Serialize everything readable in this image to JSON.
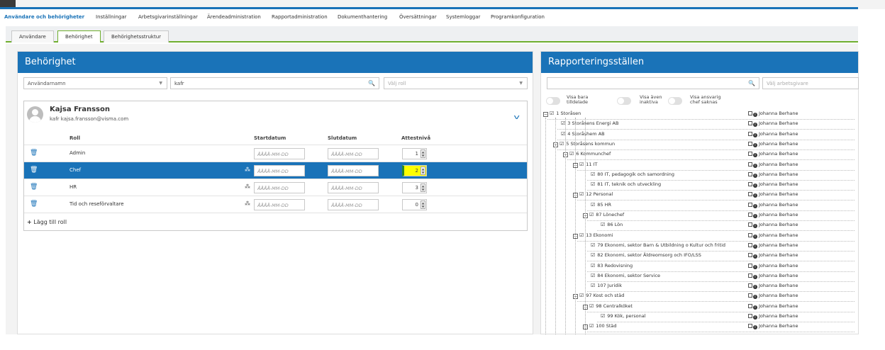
{
  "main_nav": [
    "Användare och behörigheter",
    "Inställningar",
    "Arbetsgivarinställningar",
    "Ärendeadministration",
    "Rapportadministration",
    "Dokumenthantering",
    "Översättningar",
    "Systemloggar",
    "Programkonfiguration"
  ],
  "sub_tabs": [
    "Användare",
    "Behörighet",
    "Behörighetsstruktur"
  ],
  "left_panel": {
    "title": "Behörighet",
    "filter_select": "Användarnamn",
    "search_value": "kafr",
    "role_placeholder": "Välj roll",
    "user": {
      "name": "Kajsa Fransson",
      "email": "kafr kajsa.fransson@visma.com"
    },
    "columns": {
      "role": "Roll",
      "start": "Startdatum",
      "end": "Slutdatum",
      "level": "Attestnivå"
    },
    "date_placeholder": "ÅÅÅÅ-MM-DD",
    "roles": [
      {
        "name": "Admin",
        "level": "1",
        "org_icon": false,
        "selected": false
      },
      {
        "name": "Chef",
        "level": "2",
        "org_icon": true,
        "selected": true
      },
      {
        "name": "HR",
        "level": "3",
        "org_icon": true,
        "selected": false
      },
      {
        "name": "Tid och reseförvaltare",
        "level": "0",
        "org_icon": true,
        "selected": false
      }
    ],
    "add_role": "Lägg till roll"
  },
  "right_panel": {
    "title": "Rapporteringsställen",
    "employer_placeholder": "Välj arbetsgivare",
    "toggles": [
      {
        "label_line1": "Visa bara",
        "label_line2": "tilldelade"
      },
      {
        "label_line1": "Visa även",
        "label_line2": "inaktiva"
      },
      {
        "label_line1": "Visa ansvarig",
        "label_line2": "chef saknas"
      }
    ],
    "tree": [
      {
        "label": "1 Storåsen",
        "depth": 0,
        "expand": true
      },
      {
        "label": "3 Storåsens Energi AB",
        "depth": 1,
        "expand": false
      },
      {
        "label": "4 Storåshem AB",
        "depth": 1,
        "expand": false
      },
      {
        "label": "5 Storåsens kommun",
        "depth": 1,
        "expand": true
      },
      {
        "label": "6 Kommunchef",
        "depth": 2,
        "expand": true
      },
      {
        "label": "11 IT",
        "depth": 3,
        "expand": true
      },
      {
        "label": "80 IT, pedagogik och samordning",
        "depth": 4,
        "expand": false
      },
      {
        "label": "81 IT, teknik och utveckling",
        "depth": 4,
        "expand": false
      },
      {
        "label": "12 Personal",
        "depth": 3,
        "expand": true
      },
      {
        "label": "85 HR",
        "depth": 4,
        "expand": false
      },
      {
        "label": "87 Lönechef",
        "depth": 4,
        "expand": true
      },
      {
        "label": "86 Lön",
        "depth": 5,
        "expand": false
      },
      {
        "label": "13 Ekonomi",
        "depth": 3,
        "expand": true
      },
      {
        "label": "79 Ekonomi, sektor Barn & Utbildning o Kultur och fritid",
        "depth": 4,
        "expand": false
      },
      {
        "label": "82 Ekonomi, sektor Äldreomsorg och IFO/LSS",
        "depth": 4,
        "expand": false
      },
      {
        "label": "83 Redovisning",
        "depth": 4,
        "expand": false
      },
      {
        "label": "84 Ekonomi, sektor Service",
        "depth": 4,
        "expand": false
      },
      {
        "label": "107 Juridik",
        "depth": 4,
        "expand": false
      },
      {
        "label": "97 Kost och städ",
        "depth": 3,
        "expand": true
      },
      {
        "label": "98 Centralköket",
        "depth": 4,
        "expand": true
      },
      {
        "label": "99 Kök, personal",
        "depth": 5,
        "expand": false
      },
      {
        "label": "100 Städ",
        "depth": 4,
        "expand": true
      }
    ],
    "responsible": "Johanna Berhane"
  }
}
